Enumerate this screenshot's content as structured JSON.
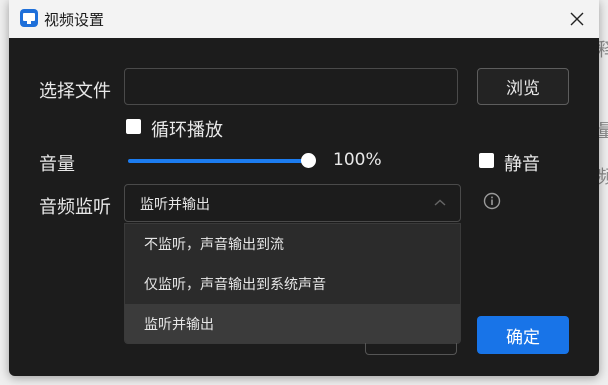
{
  "window": {
    "title": "视频设置"
  },
  "file": {
    "label": "选择文件",
    "value": "",
    "browse_label": "浏览"
  },
  "loop": {
    "label": "循环播放",
    "checked": false
  },
  "volume": {
    "label": "音量",
    "value_text": "100%",
    "level": 1.0
  },
  "mute": {
    "label": "静音",
    "checked": false
  },
  "monitor": {
    "label": "音频监听",
    "selected": "监听并输出",
    "options": [
      "不监听，声音输出到流",
      "仅监听，声音输出到系统声音",
      "监听并输出"
    ]
  },
  "footer": {
    "ok_label": "确定"
  },
  "background_glyphs": [
    "释",
    "量",
    "频"
  ],
  "colors": {
    "accent": "#1874e8",
    "dialog_bg": "#1c1c1c",
    "titlebar_bg": "#f3f3f3"
  },
  "icons": {
    "app": "video-app-icon",
    "close": "close-icon",
    "info": "info-icon",
    "dropdown": "chevron-up-icon"
  }
}
